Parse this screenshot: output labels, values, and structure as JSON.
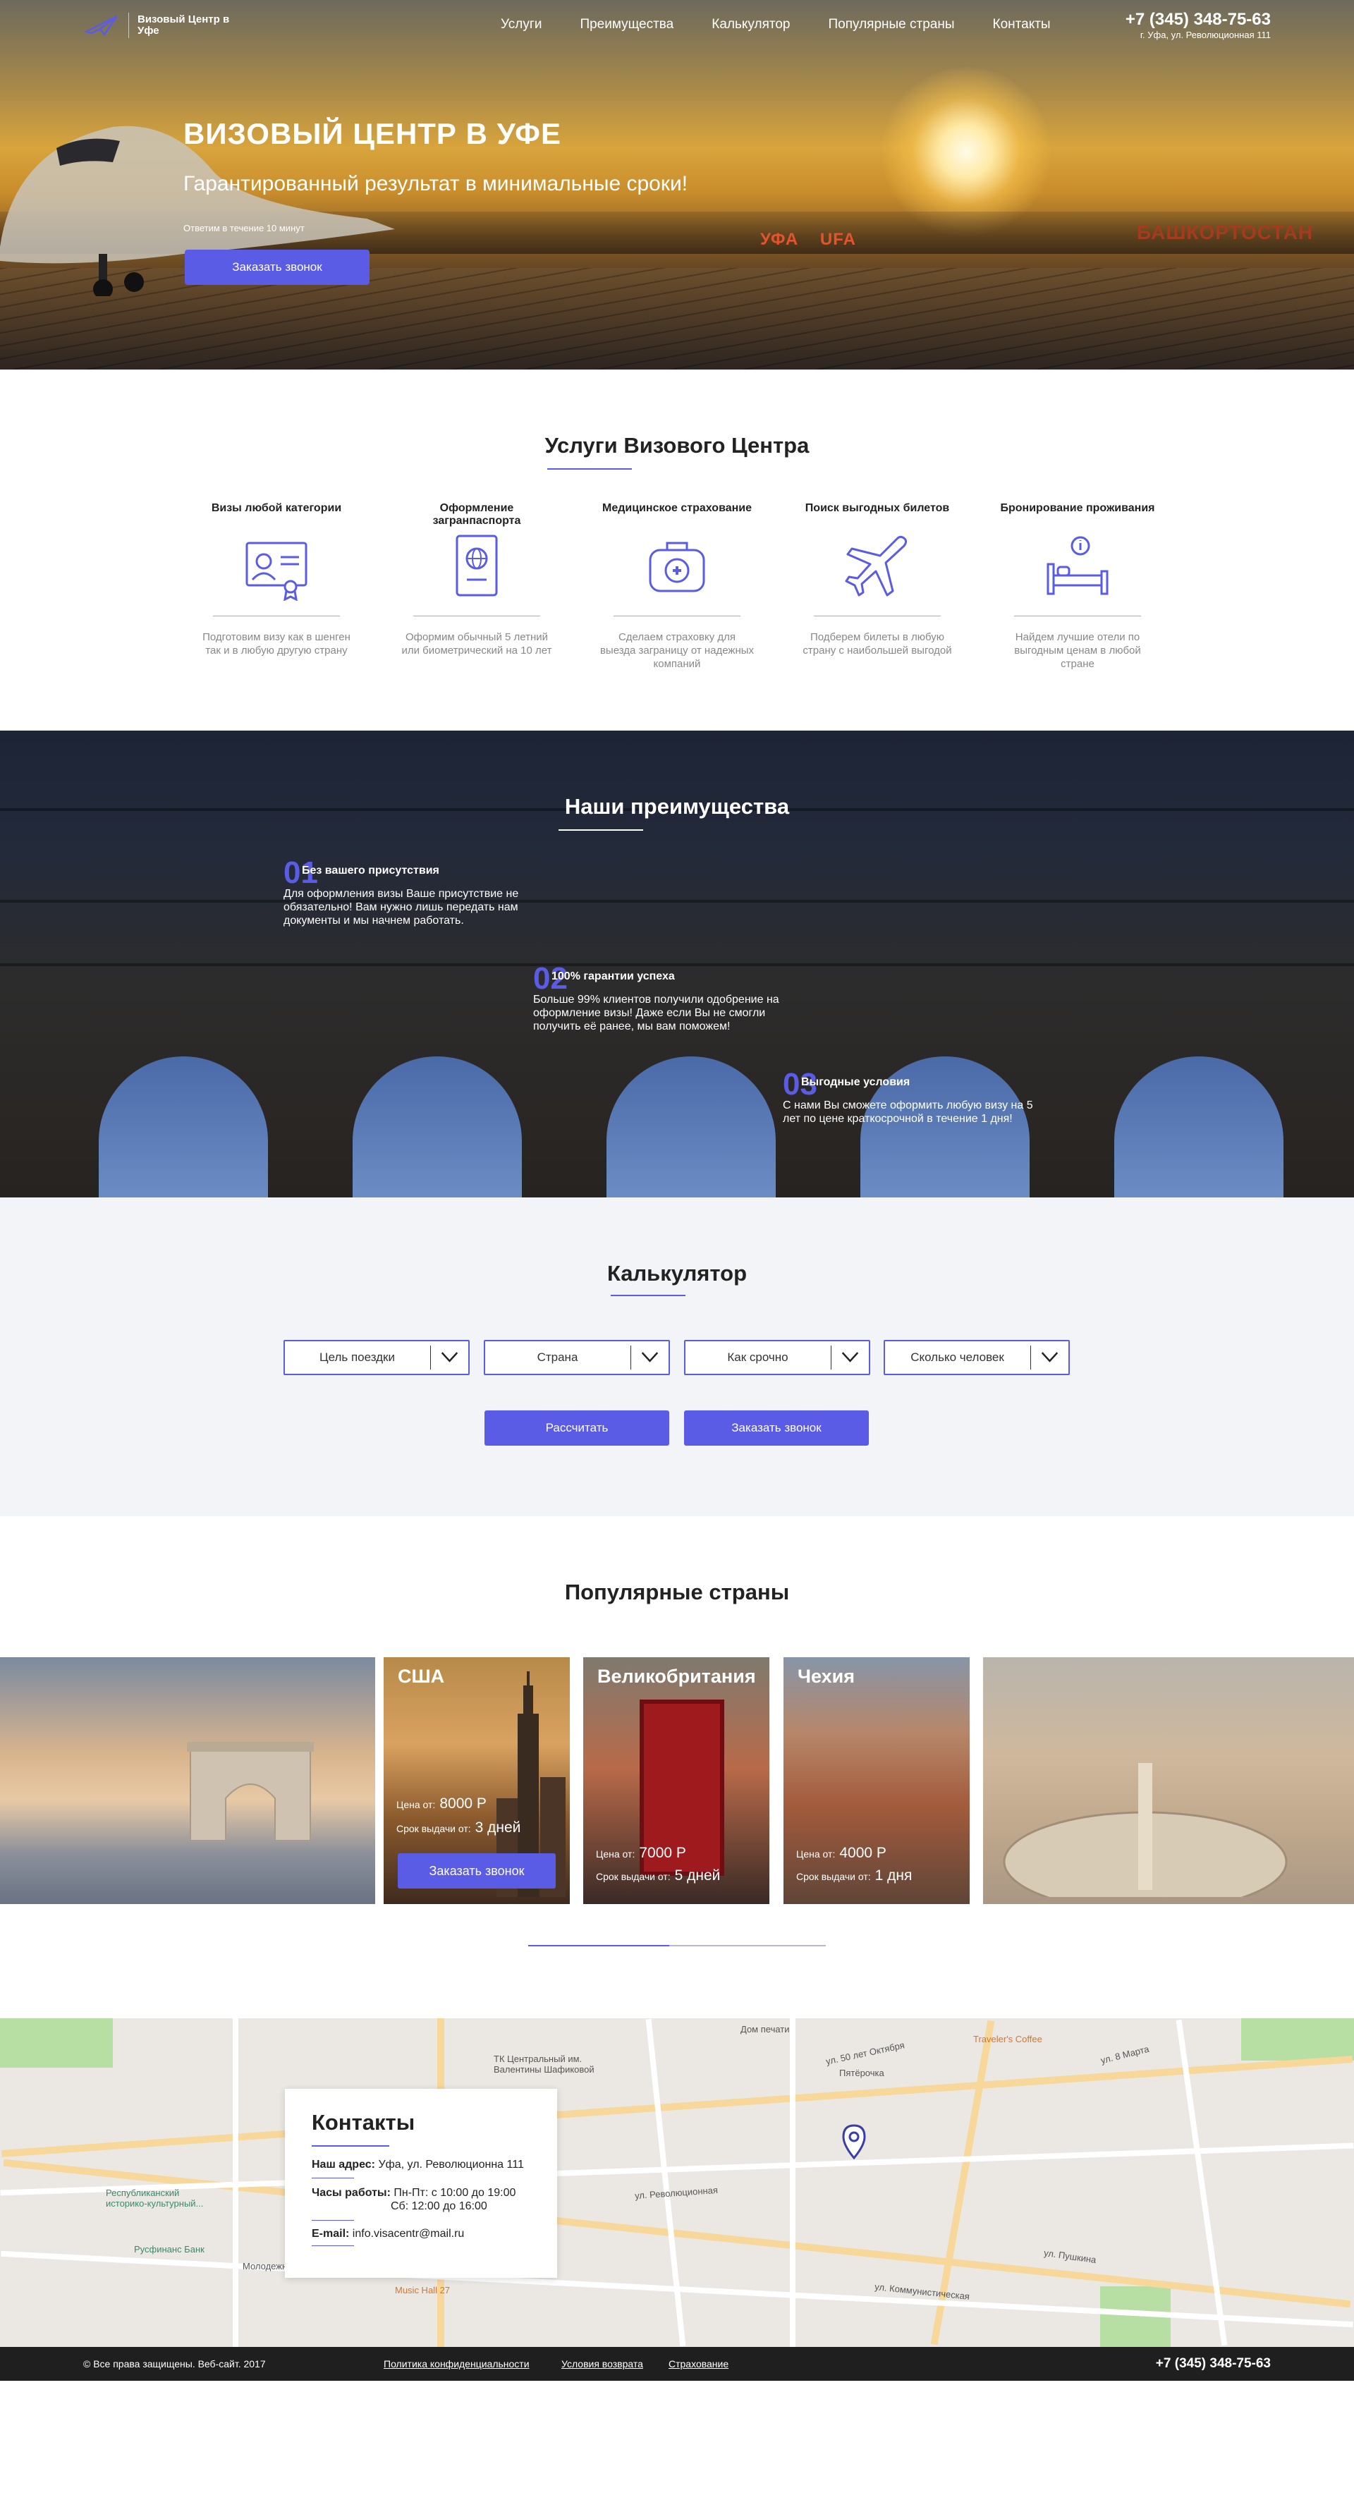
{
  "header": {
    "logo_text": "Визовый Центр в Уфе",
    "menu": [
      "Услуги",
      "Преимущества",
      "Калькулятор",
      "Популярные страны",
      "Контакты"
    ],
    "phone": "+7 (345) 348-75-63",
    "address": "г. Уфа, ул. Революционная 111"
  },
  "hero": {
    "title": "ВИЗОВЫЙ ЦЕНТР В УФЕ",
    "subtitle": "Гарантированный результат в минимальные сроки!",
    "note": "Ответим в течение 10 минут",
    "button": "Заказать звонок",
    "signs": [
      "УФА",
      "UFA",
      "БАШКОРТОСТАН"
    ]
  },
  "services": {
    "title": "Услуги Визового Центра",
    "items": [
      {
        "title": "Визы любой категории",
        "icon": "certificate-icon",
        "text": "Подготовим визу как в шенген так и в любую другую страну"
      },
      {
        "title": "Оформление загранпаспорта",
        "icon": "passport-icon",
        "text": "Оформим обычный 5 летний или биометрический на 10 лет"
      },
      {
        "title": "Медицинское страхование",
        "icon": "medical-kit-icon",
        "text": "Сделаем страховку для выезда заграницу от надежных компаний"
      },
      {
        "title": "Поиск выгодных билетов",
        "icon": "airplane-icon",
        "text": "Подберем билеты в любую страну с наибольшей выгодой"
      },
      {
        "title": "Бронирование проживания",
        "icon": "bed-icon",
        "text": "Найдем лучшие отели по выгодным ценам в любой стране"
      }
    ]
  },
  "advantages": {
    "title": "Наши преимущества",
    "items": [
      {
        "num": "01",
        "title": "Без вашего присутствия",
        "text": "Для оформления визы Ваше присутствие не обязательно! Вам нужно лишь передать нам документы и мы начнем работать."
      },
      {
        "num": "02",
        "title": "100% гарантии успеха",
        "text": "Больше 99% клиентов получили одобрение на оформление визы! Даже если Вы не смогли получить её ранее, мы вам поможем!"
      },
      {
        "num": "03",
        "title": "Выгодные условия",
        "text": "С нами Вы сможете оформить любую визу на 5 лет по цене краткосрочной в течение 1 дня!"
      }
    ]
  },
  "calculator": {
    "title": "Калькулятор",
    "selects": [
      "Цель поездки",
      "Страна",
      "Как срочно",
      "Сколько человек"
    ],
    "calc_button": "Рассчитать",
    "call_button": "Заказать звонок"
  },
  "countries": {
    "title": "Популярные страны",
    "price_label": "Цена от:",
    "term_label": "Срок выдачи от:",
    "button": "Заказать звонок",
    "cards": [
      {
        "name": "США",
        "price": "8000 Р",
        "term": "3 дней"
      },
      {
        "name": "Великобритания",
        "price": "7000 Р",
        "term": "5 дней"
      },
      {
        "name": "Чехия",
        "price": "4000 Р",
        "term": "1 дня"
      }
    ]
  },
  "contacts": {
    "title": "Контакты",
    "address_label": "Наш адрес:",
    "address": "Уфа, ул. Революционна 111",
    "hours_label": "Часы работы:",
    "hours1": "Пн-Пт: с 10:00 до 19:00",
    "hours2": "Сб: 12:00 до 16:00",
    "email_label": "E-mail:",
    "email": "info.visacentr@mail.ru"
  },
  "map_labels": [
    "Дом печати",
    "ТК Центральный им. Валентины Шафиковой",
    "Пятёрочка",
    "Traveler's Coffee",
    "Республиканский историко-культурный...",
    "Русфинанс Банк",
    "Молодежный",
    "Music Hall 27",
    "ул. 50 лет Октября",
    "ул. Революционная",
    "ул. 8 Марта",
    "ул. Коммунистическая",
    "ул. Пушкина"
  ],
  "footer": {
    "copyright": "© Все права защищены. Веб-сайт. 2017",
    "links": [
      "Политика конфиденциальности",
      "Условия возврата",
      "Страхование"
    ],
    "phone": "+7 (345) 348-75-63"
  },
  "colors": {
    "accent": "#5b5ce6",
    "footer": "#1f1f1f",
    "calc_bg": "#f3f4f7"
  }
}
